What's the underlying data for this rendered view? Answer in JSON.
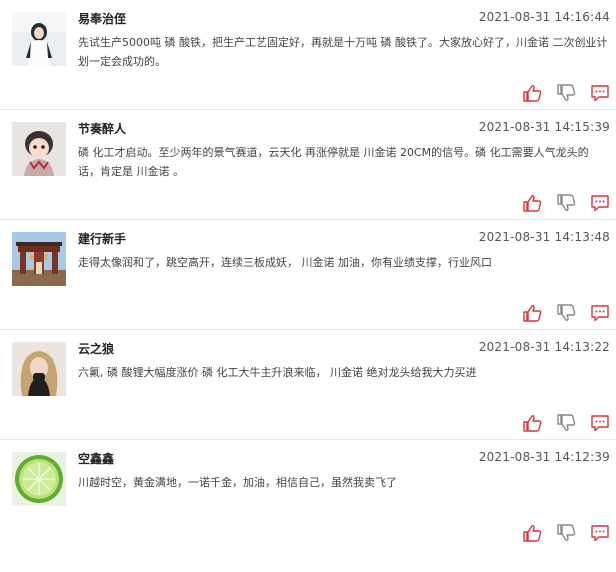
{
  "colors": {
    "accent_red": "#d9343d",
    "icon_gray": "#888888"
  },
  "comments": [
    {
      "username": "易奉治侄",
      "timestamp": "2021-08-31 14:16:44",
      "content": "先试生产5000吨 磷 酸铁，把生产工艺固定好，再就是十万吨 磷 酸铁了。大家放心好了，川金诺 二次创业计划一定会成功的。"
    },
    {
      "username": "节奏醉人",
      "timestamp": "2021-08-31 14:15:39",
      "content": "磷 化工才启动。至少两年的景气赛道，云天化 再涨停就是 川金诺 20CM的信号。磷 化工需要人气龙头的话，肯定是 川金诺 。"
    },
    {
      "username": "建行新手",
      "timestamp": "2021-08-31 14:13:48",
      "content": "走得太像润和了，跳空高开，连续三板成妖， 川金诺 加油，你有业绩支撑，行业风口"
    },
    {
      "username": "云之狼",
      "timestamp": "2021-08-31 14:13:22",
      "content": "六氟, 磷 酸锂大幅度涨价 磷 化工大牛主升浪来临， 川金诺 绝对龙头给我大力买进"
    },
    {
      "username": "空鑫鑫",
      "timestamp": "2021-08-31 14:12:39",
      "content": "川越时空，黄金满地，一诺千金，加油，相信自己，虽然我卖飞了"
    }
  ]
}
